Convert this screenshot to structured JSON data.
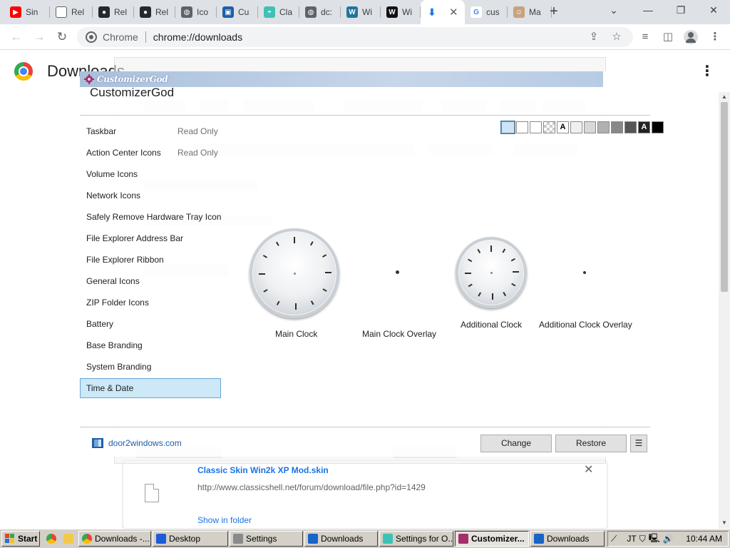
{
  "browser": {
    "tabs": [
      {
        "title": "Sin",
        "icon": "youtube-icon"
      },
      {
        "title": "Rel",
        "icon": "file-icon"
      },
      {
        "title": "Rel",
        "icon": "github-icon"
      },
      {
        "title": "Rel",
        "icon": "github-icon"
      },
      {
        "title": "Ico",
        "icon": "globe-icon"
      },
      {
        "title": "Cu",
        "icon": "app-icon"
      },
      {
        "title": "Cla",
        "icon": "shell-icon"
      },
      {
        "title": "dc:",
        "icon": "globe-icon"
      },
      {
        "title": "Wi",
        "icon": "wordpress-icon"
      },
      {
        "title": "Wi",
        "icon": "w-icon"
      },
      {
        "title": "",
        "icon": "download-icon"
      },
      {
        "title": "cus",
        "icon": "google-icon"
      },
      {
        "title": "Ma",
        "icon": "avatar-icon"
      }
    ],
    "omnibox": {
      "site": "Chrome",
      "url": "chrome://downloads"
    }
  },
  "downloads": {
    "title": "Downloads",
    "item": {
      "name": "Classic Skin Win2k XP Mod.skin",
      "url": "http://www.classicshell.net/forum/download/file.php?id=1429",
      "show": "Show in folder"
    }
  },
  "customizer": {
    "window_title": "CustomizerGod",
    "heading": "CustomizerGod",
    "categories": [
      {
        "label": "Taskbar",
        "status": "Read Only"
      },
      {
        "label": "Action Center Icons",
        "status": "Read Only"
      },
      {
        "label": "Volume Icons",
        "status": ""
      },
      {
        "label": "Network Icons",
        "status": ""
      },
      {
        "label": "Safely Remove Hardware Tray Icon",
        "status": ""
      },
      {
        "label": "File Explorer Address Bar",
        "status": ""
      },
      {
        "label": "File Explorer Ribbon",
        "status": ""
      },
      {
        "label": "General Icons",
        "status": ""
      },
      {
        "label": "ZIP Folder Icons",
        "status": ""
      },
      {
        "label": "Battery",
        "status": ""
      },
      {
        "label": "Base Branding",
        "status": ""
      },
      {
        "label": "System Branding",
        "status": ""
      },
      {
        "label": "Time & Date",
        "status": ""
      }
    ],
    "selected_category": "Time & Date",
    "swatch_colors": [
      "#cce4f7",
      "#ffffff",
      "#ffffff",
      "#e8e8e8",
      "#ffffff",
      "#f0f0f0",
      "#d8d8d8",
      "#b0b0b0",
      "#888888",
      "#555555",
      "#222222",
      "#000000"
    ],
    "swatch_labels": [
      "",
      "",
      "",
      "",
      "A",
      "",
      "",
      "",
      "",
      "",
      "A",
      ""
    ],
    "resources": [
      {
        "label": "Main Clock"
      },
      {
        "label": "Main Clock Overlay"
      },
      {
        "label": "Additional Clock"
      },
      {
        "label": "Additional Clock Overlay"
      }
    ],
    "footer_link": "door2windows.com",
    "buttons": {
      "change": "Change",
      "restore": "Restore",
      "menu": "☰"
    }
  },
  "taskbar": {
    "start": "Start",
    "items": [
      {
        "label": "Downloads -...",
        "icon": "chrome-icon"
      },
      {
        "label": "Desktop",
        "icon": "desktop-icon"
      },
      {
        "label": "Settings",
        "icon": "gear-icon"
      },
      {
        "label": "Downloads",
        "icon": "download-folder-icon"
      },
      {
        "label": "Settings for O...",
        "icon": "shell-icon"
      },
      {
        "label": "Customizer...",
        "icon": "app-icon"
      },
      {
        "label": "Downloads",
        "icon": "download-folder-icon"
      }
    ],
    "time": "10:44 AM"
  },
  "colors": {
    "accent": "#1a73e8",
    "selection": "#cde8f6"
  }
}
